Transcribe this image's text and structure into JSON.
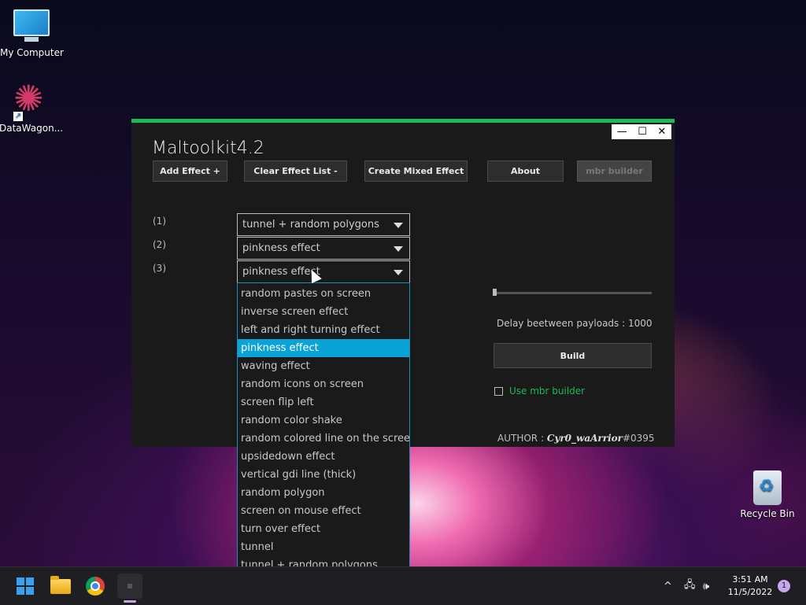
{
  "desktop": {
    "icons": [
      {
        "label": "My Computer"
      },
      {
        "label": "DataWagon..."
      },
      {
        "label": "Recycle Bin"
      }
    ]
  },
  "app": {
    "title": "Maltoolkit4.2",
    "window_controls": {
      "minimize": "—",
      "maximize": "☐",
      "close": "✕"
    },
    "toolbar": {
      "add_effect": "Add Effect +",
      "clear_effect_list": "Clear Effect List -",
      "create_mixed_effect": "Create Mixed Effect",
      "about": "About",
      "mbr_builder": "mbr builder"
    },
    "rows": [
      {
        "label": "(1)",
        "value": "tunnel + random polygons"
      },
      {
        "label": "(2)",
        "value": "pinkness effect"
      },
      {
        "label": "(3)",
        "value": "pinkness effect"
      }
    ],
    "dropdown_options": [
      "random pastes on screen",
      "inverse screen effect",
      "left and right turning effect",
      "pinkness effect",
      "waving effect",
      "random icons on screen",
      "screen flip left",
      "random color shake",
      "random colored line on the screen",
      "upsidedown effect",
      "vertical gdi line (thick)",
      "random polygon",
      "screen on mouse effect",
      "turn over effect",
      "tunnel",
      "tunnel + random polygons"
    ],
    "dropdown_selected_index": 3,
    "slider_level": 0,
    "delay_label": "Delay beetween payloads : 1000",
    "build_label": "Build",
    "use_mbr_label": "Use mbr builder",
    "author_prefix": "AUTHOR : ",
    "author_name": "Cyr0_waArrior",
    "author_tag": "#0395"
  },
  "taskbar": {
    "tray_chevron": "^",
    "tray_network": "🖧",
    "tray_volume": "🕪",
    "time": "3:51 AM",
    "date": "11/5/2022",
    "notifications": "1"
  }
}
